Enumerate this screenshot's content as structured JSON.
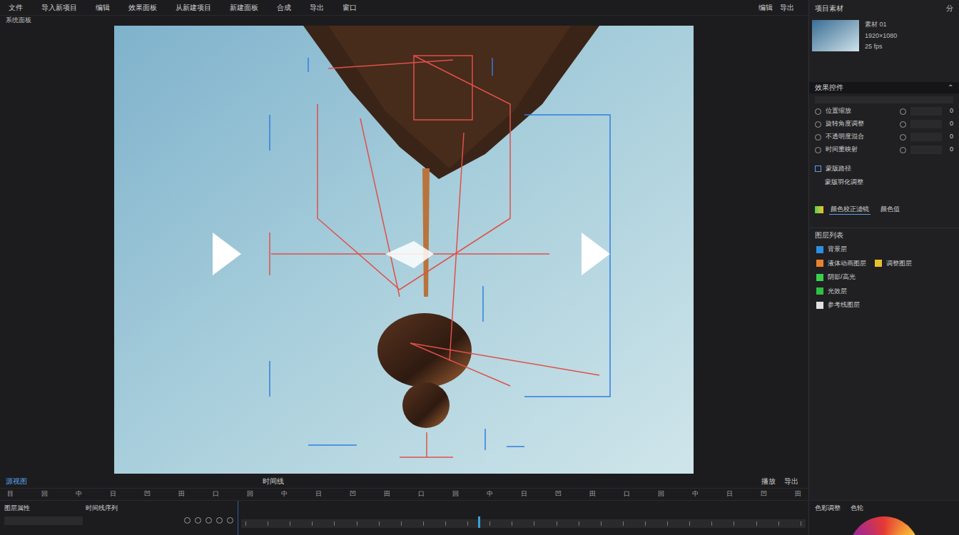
{
  "menu_bar": {
    "items": [
      "文件",
      "导入新项目",
      "编辑",
      "效果面板",
      "从新建项目",
      "新建面板",
      "合成",
      "导出",
      "窗口"
    ],
    "right_items": [
      "编辑",
      "导出"
    ]
  },
  "sub_bar": {
    "label": "系统面板"
  },
  "transport": {
    "left_label": "源视图",
    "center_label": "时间线",
    "right_label": "播放",
    "right_label2": "导出"
  },
  "toolbar": {
    "items": [
      "目",
      "回",
      "中",
      "日",
      "凹",
      "田",
      "口",
      "回",
      "中",
      "日",
      "凹",
      "田",
      "口",
      "回",
      "中",
      "日",
      "凹",
      "田",
      "口",
      "回",
      "中",
      "日",
      "凹",
      "田"
    ]
  },
  "project_panel": {
    "title": "项目素材",
    "action": "分",
    "clip": {
      "name": "素材 01",
      "meta": "1920×1080",
      "extra": "25 fps"
    }
  },
  "effects_panel": {
    "title": "效果控件",
    "rows": [
      {
        "label": "位置缩放",
        "value": "0"
      },
      {
        "label": "旋转角度调整",
        "value": "0"
      },
      {
        "label": "不透明度混合",
        "value": "0"
      },
      {
        "label": "时间重映射",
        "value": "0"
      }
    ],
    "mask": {
      "title": "蒙版路径",
      "sub": "蒙版羽化调整"
    },
    "color_row": {
      "label": "颜色校正滤镜",
      "value": "颜色值"
    }
  },
  "layers_panel": {
    "title": "图层列表",
    "rows": [
      {
        "entries": [
          {
            "label": "背景层",
            "color": "#2d8fe0"
          }
        ]
      },
      {
        "entries": [
          {
            "label": "液体动画图层",
            "color": "#e9822f"
          },
          {
            "label": "调整图层",
            "color": "#e8c02c"
          }
        ]
      },
      {
        "entries": [
          {
            "label": "阴影/高光",
            "color": "#3ccf4e"
          }
        ]
      },
      {
        "entries": [
          {
            "label": "光效层",
            "color": "#2fbf44"
          }
        ]
      },
      {
        "entries": [
          {
            "label": "参考线图层",
            "color": "#e0e0e0"
          }
        ]
      }
    ]
  },
  "timeline_panel": {
    "title": "图层属性",
    "sequence_label": "时间线序列",
    "playhead": {
      "level": 0.42
    }
  },
  "color_panel": {
    "title": "色彩调整",
    "tab": "色轮"
  }
}
